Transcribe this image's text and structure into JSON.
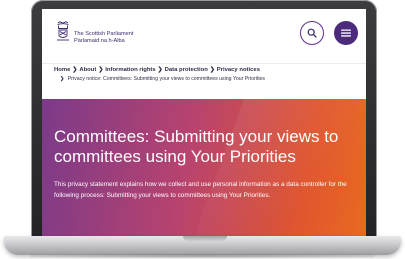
{
  "header": {
    "logo_line1": "The Scottish Parliament",
    "logo_line2": "Pàrlamaid na h-Alba",
    "logo_icon": "crest-icon",
    "search_icon": "search-icon",
    "menu_icon": "menu-icon"
  },
  "breadcrumb": {
    "items": [
      "Home",
      "About",
      "Information rights",
      "Data protection",
      "Privacy notices"
    ],
    "current": "Privacy notice: Committees: Submitting your views to committees using Your Priorities",
    "separator": "❯"
  },
  "hero": {
    "title": "Committees: Submitting your views to committees using Your Priorities",
    "description": "This privacy statement explains how we collect and use personal information as a data controller for the following process: Submitting your views to committees using Your Priorities."
  },
  "colors": {
    "brand_purple": "#4c2a7c",
    "gradient_start": "#7b3a8a",
    "gradient_end": "#e96a20"
  }
}
